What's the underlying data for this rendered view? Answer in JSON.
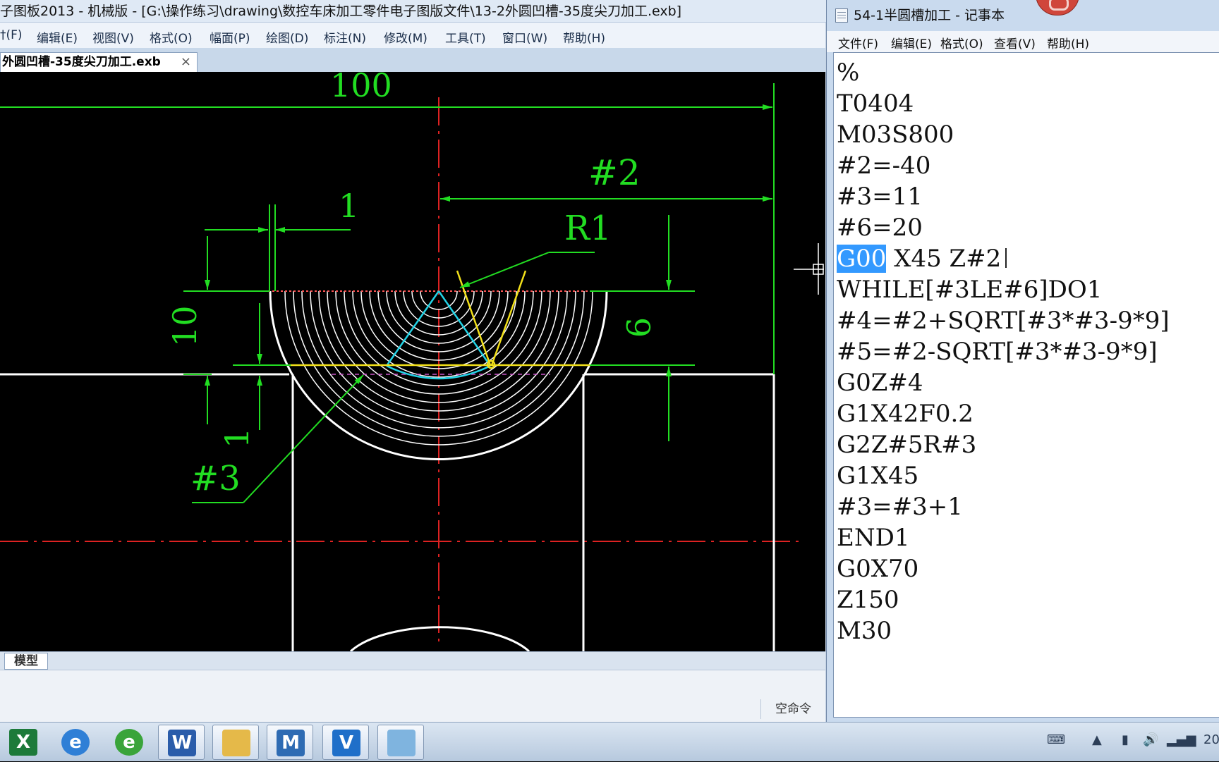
{
  "cad": {
    "title": "子图板2013 - 机械版 - [G:\\操作练习\\drawing\\数控车床加工零件电子图版文件\\13-2外圆凹槽-35度尖刀加工.exb]",
    "menu": [
      "†(F)",
      "编辑(E)",
      "视图(V)",
      "格式(O)",
      "幅面(P)",
      "绘图(D)",
      "标注(N)",
      "修改(M)",
      "工具(T)",
      "窗口(W)",
      "帮助(H)"
    ],
    "doc_tab": "外圆凹槽-35度尖刀加工.exb",
    "doc_tab_close": "×",
    "model_tab": "模型",
    "command_status": "空命令",
    "dimensions": {
      "overall_length": "100",
      "var_length": "#2",
      "width_1": "1",
      "radius": "R1",
      "height_10": "10",
      "height_9": "9",
      "depth_1": "1",
      "var_radius": "#3"
    },
    "colors": {
      "dimension": "#22dd22",
      "centerline": "#dd2222",
      "outline": "#ffffff",
      "tool": "#f2e01a",
      "toolpath": "#22d3e6",
      "hidden": "#cc55cc"
    }
  },
  "notepad": {
    "title": "54-1半圆槽加工 - 记事本",
    "menu": [
      "文件(F)",
      "编辑(E)",
      "格式(O)",
      "查看(V)",
      "帮助(H)"
    ],
    "lines": [
      "%",
      "T0404",
      "M03S800",
      "#2=-40",
      "#3=11",
      "#6=20",
      "",
      "WHILE[#3LE#6]DO1",
      "#4=#2+SQRT[#3*#3-9*9]",
      "#5=#2-SQRT[#3*#3-9*9]",
      "G0Z#4",
      "G1X42F0.2",
      "G2Z#5R#3",
      "G1X45",
      "#3=#3+1",
      "END1",
      "G0X70",
      "Z150",
      "M30"
    ],
    "selected_text": "G00",
    "line7_rest": " X45 Z#2"
  },
  "taskbar": {
    "apps": [
      {
        "name": "excel-icon",
        "glyph": "X",
        "color": "#1d7a3a"
      },
      {
        "name": "ie-icon",
        "glyph": "e",
        "color": "#2f7fd6"
      },
      {
        "name": "ie-green-icon",
        "glyph": "e",
        "color": "#3aa43a"
      },
      {
        "name": "word-icon",
        "glyph": "W",
        "color": "#2a5caa"
      },
      {
        "name": "folder-icon",
        "glyph": "",
        "color": "#e5b949"
      },
      {
        "name": "caxa-icon",
        "glyph": "M",
        "color": "#2e6bb3"
      },
      {
        "name": "app-v-icon",
        "glyph": "V",
        "color": "#1f6fc9"
      },
      {
        "name": "notepad-icon",
        "glyph": "",
        "color": "#7fb4df"
      }
    ],
    "clock_partial": "20"
  }
}
